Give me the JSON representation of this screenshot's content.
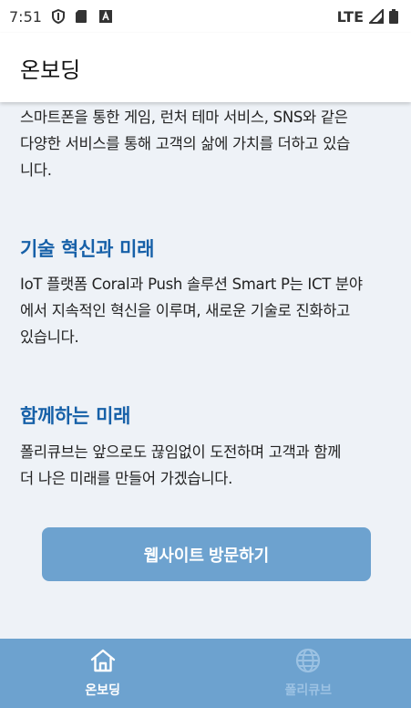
{
  "status_bar": {
    "time": "7:51",
    "network": "LTE",
    "icons": [
      "shield-icon",
      "sd-card-icon",
      "app-notification-icon",
      "signal-icon",
      "battery-icon"
    ]
  },
  "app_bar": {
    "title": "온보딩"
  },
  "content": {
    "intro_lines": [
      "스마트폰을 통한 게임, 런처 테마 서비스, SNS와 같은",
      "다양한 서비스를 통해 고객의 삶에 가치를 더하고 있습",
      "니다."
    ],
    "sections": [
      {
        "heading": "기술 혁신과 미래",
        "lines": [
          "IoT 플랫폼 Coral과 Push 솔루션 Smart P는 ICT 분야",
          "에서 지속적인 혁신을 이루며, 새로운 기술로 진화하고",
          "있습니다."
        ]
      },
      {
        "heading": "함께하는 미래",
        "lines": [
          "폴리큐브는 앞으로도 끊임없이 도전하며 고객과 함께",
          "더 나은 미래를 만들어 가겠습니다."
        ]
      }
    ],
    "visit_button": "웹사이트 방문하기"
  },
  "bottom_nav": {
    "items": [
      {
        "label": "온보딩",
        "icon": "home-icon",
        "active": true
      },
      {
        "label": "폴리큐브",
        "icon": "globe-icon",
        "active": false
      }
    ]
  },
  "colors": {
    "accent": "#1660a8",
    "button": "#6da2cf",
    "background": "#eef2f7",
    "nav_inactive": "#9cc2e3"
  }
}
